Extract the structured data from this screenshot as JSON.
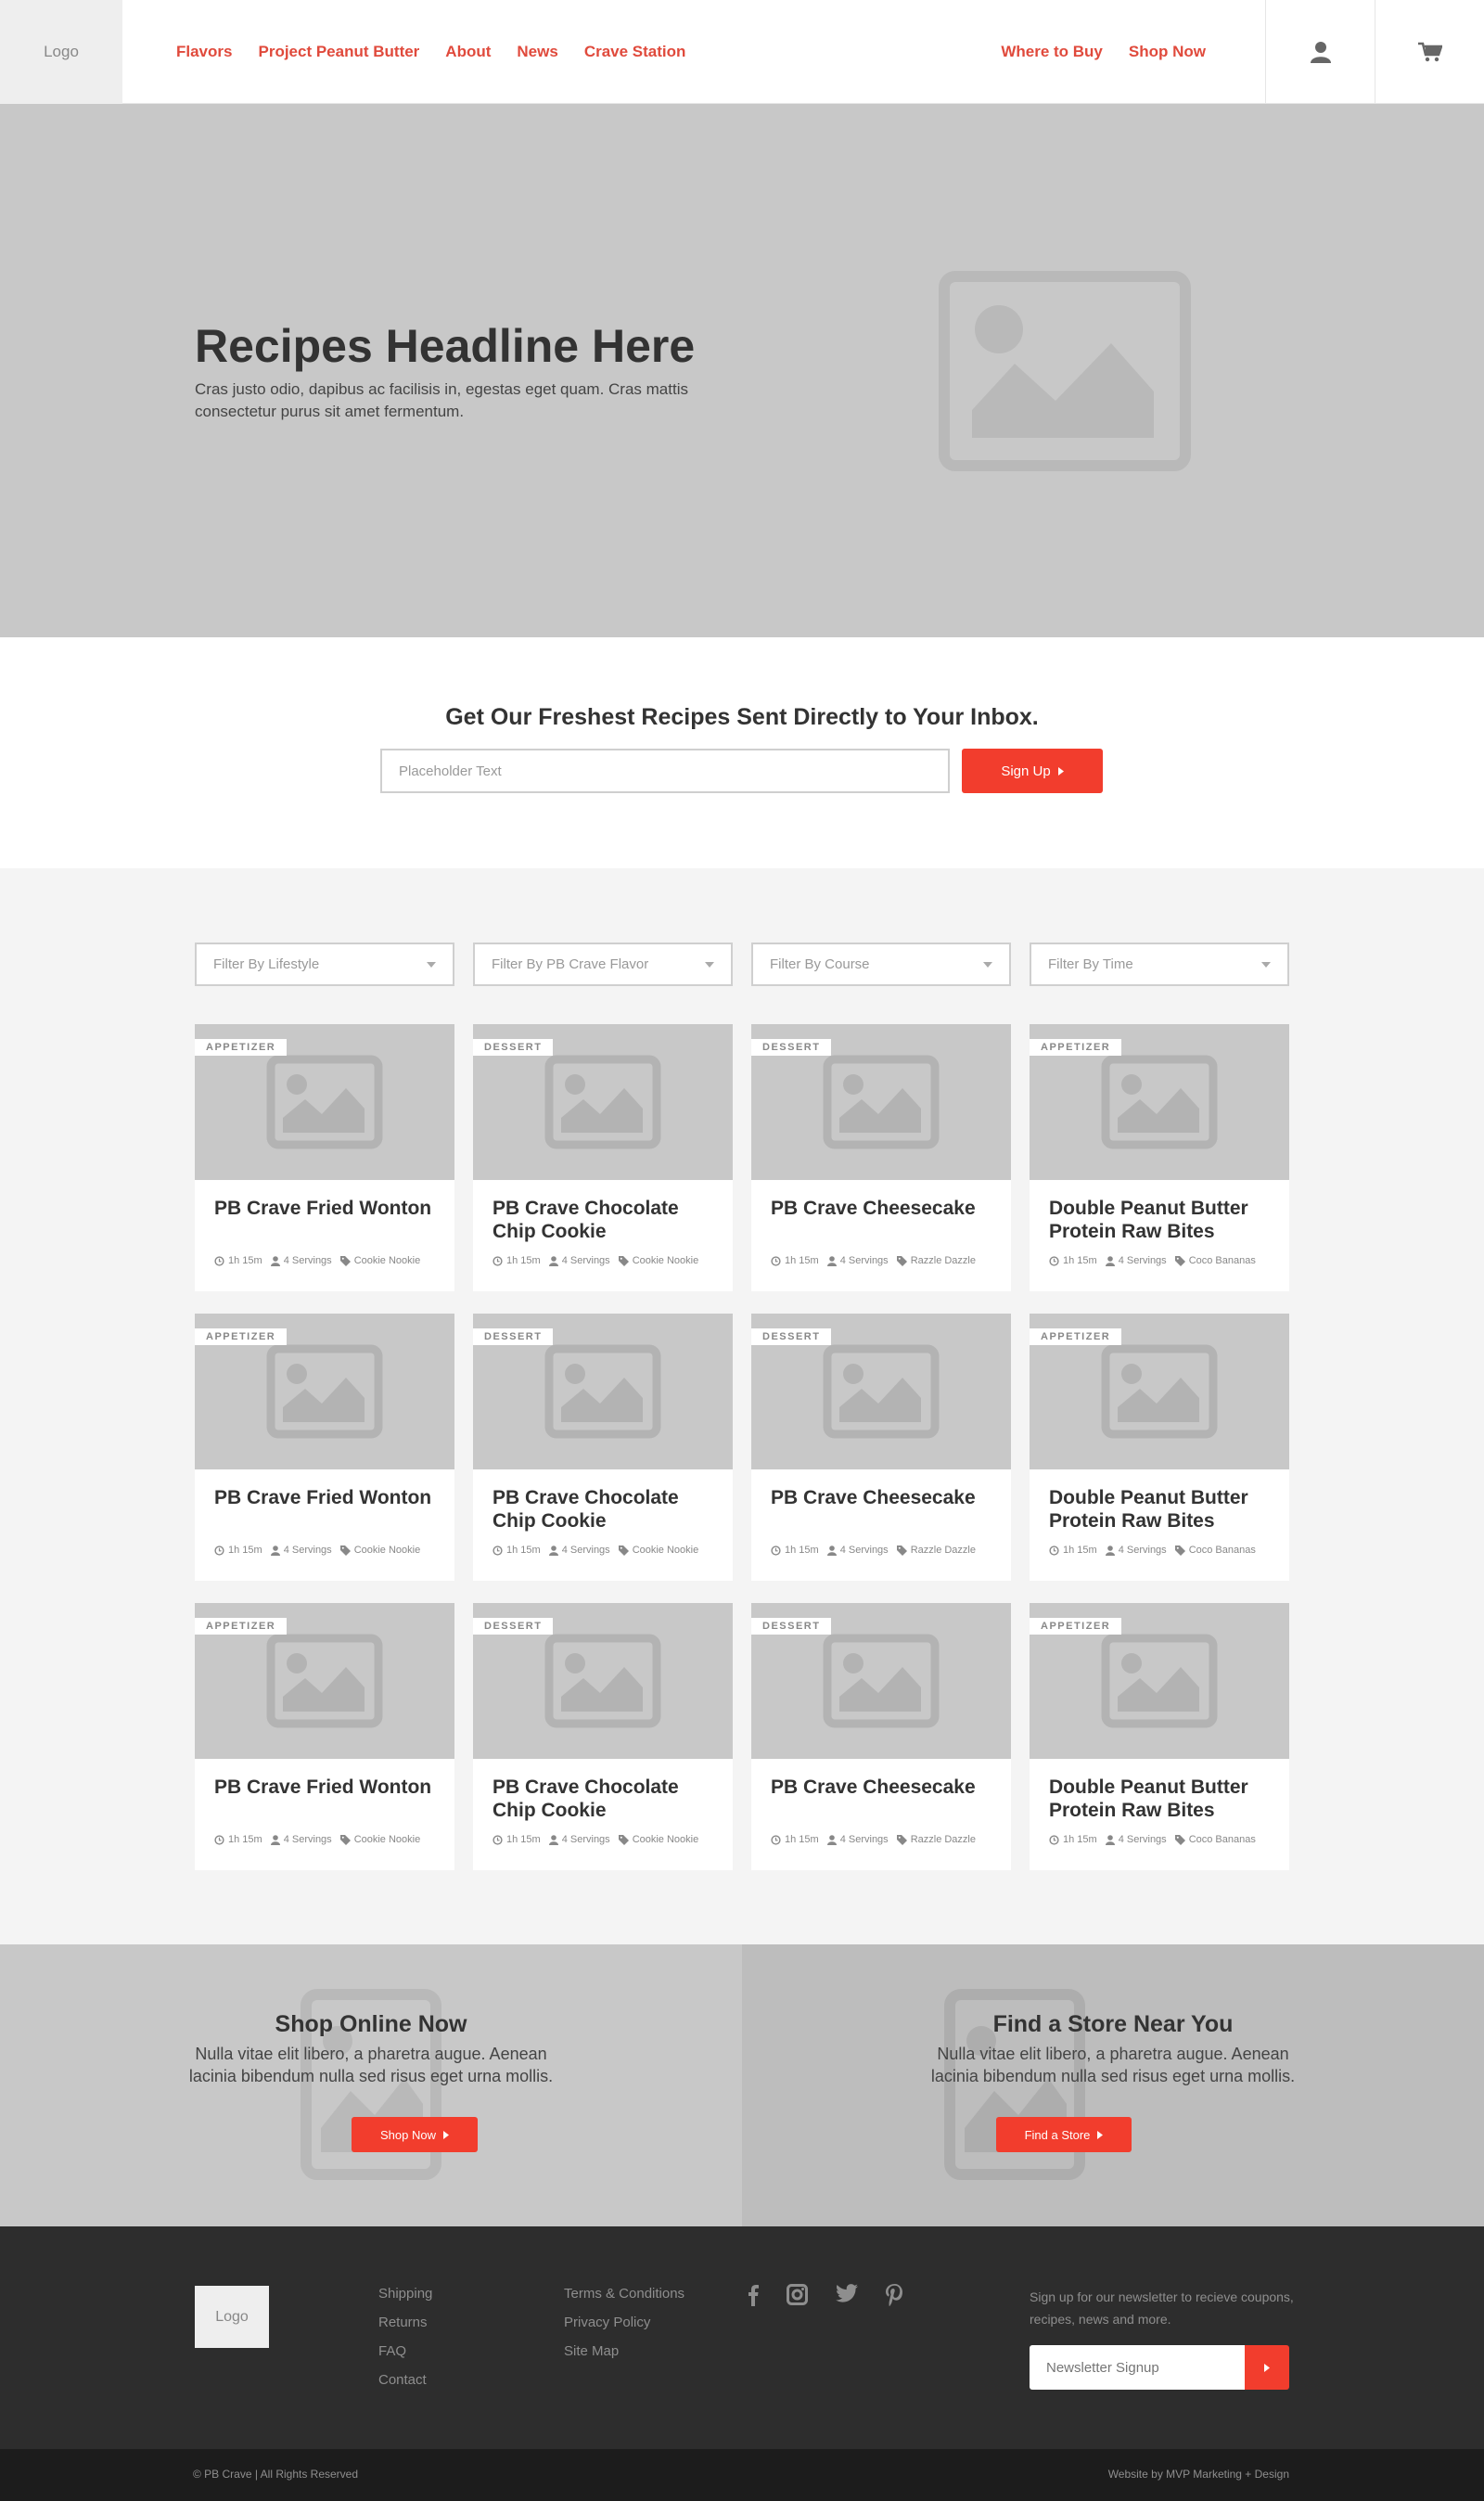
{
  "header": {
    "logo": "Logo",
    "nav_left": [
      "Flavors",
      "Project Peanut Butter",
      "About",
      "News",
      "Crave Station"
    ],
    "nav_right": [
      "Where to Buy",
      "Shop Now"
    ],
    "account_icon": "user-icon",
    "cart_icon": "cart-icon",
    "accent_color": "#e04a3c"
  },
  "hero": {
    "title": "Recipes Headline Here",
    "subtitle": "Cras justo odio, dapibus ac facilisis in, egestas eget quam. Cras mattis consectetur purus sit amet fermentum."
  },
  "newsletter": {
    "heading": "Get Our Freshest Recipes Sent Directly to Your Inbox.",
    "placeholder": "Placeholder Text",
    "button": "Sign Up",
    "button_color": "#f23d2d"
  },
  "filters": [
    "Filter By Lifestyle",
    "Filter By PB Crave Flavor",
    "Filter By Course",
    "Filter By Time"
  ],
  "recipes": [
    {
      "category": "APPETIZER",
      "title": "PB Crave Fried Wonton",
      "time": "1h 15m",
      "servings": "4 Servings",
      "flavor": "Cookie Nookie"
    },
    {
      "category": "DESSERT",
      "title": "PB Crave Chocolate Chip Cookie",
      "time": "1h 15m",
      "servings": "4 Servings",
      "flavor": "Cookie Nookie"
    },
    {
      "category": "DESSERT",
      "title": "PB Crave Cheesecake",
      "time": "1h 15m",
      "servings": "4 Servings",
      "flavor": "Razzle Dazzle"
    },
    {
      "category": "APPETIZER",
      "title": "Double Peanut Butter Protein Raw Bites",
      "time": "1h 15m",
      "servings": "4 Servings",
      "flavor": "Coco Bananas"
    },
    {
      "category": "APPETIZER",
      "title": "PB Crave Fried Wonton",
      "time": "1h 15m",
      "servings": "4 Servings",
      "flavor": "Cookie Nookie"
    },
    {
      "category": "DESSERT",
      "title": "PB Crave Chocolate Chip Cookie",
      "time": "1h 15m",
      "servings": "4 Servings",
      "flavor": "Cookie Nookie"
    },
    {
      "category": "DESSERT",
      "title": "PB Crave Cheesecake",
      "time": "1h 15m",
      "servings": "4 Servings",
      "flavor": "Razzle Dazzle"
    },
    {
      "category": "APPETIZER",
      "title": "Double Peanut Butter Protein Raw Bites",
      "time": "1h 15m",
      "servings": "4 Servings",
      "flavor": "Coco Bananas"
    },
    {
      "category": "APPETIZER",
      "title": "PB Crave Fried Wonton",
      "time": "1h 15m",
      "servings": "4 Servings",
      "flavor": "Cookie Nookie"
    },
    {
      "category": "DESSERT",
      "title": "PB Crave Chocolate Chip Cookie",
      "time": "1h 15m",
      "servings": "4 Servings",
      "flavor": "Cookie Nookie"
    },
    {
      "category": "DESSERT",
      "title": "PB Crave Cheesecake",
      "time": "1h 15m",
      "servings": "4 Servings",
      "flavor": "Razzle Dazzle"
    },
    {
      "category": "APPETIZER",
      "title": "Double Peanut Butter Protein Raw Bites",
      "time": "1h 15m",
      "servings": "4 Servings",
      "flavor": "Coco Bananas"
    }
  ],
  "promos": {
    "shop": {
      "title": "Shop Online Now",
      "text": "Nulla vitae elit libero, a pharetra augue. Aenean lacinia bibendum nulla sed risus eget urna mollis.",
      "button": "Shop Now"
    },
    "store": {
      "title": "Find a Store Near You",
      "text": "Nulla vitae elit libero, a pharetra augue. Aenean lacinia bibendum nulla sed risus eget urna mollis.",
      "button": "Find a Store"
    }
  },
  "footer": {
    "logo": "Logo",
    "col1": [
      "Shipping",
      "Returns",
      "FAQ",
      "Contact"
    ],
    "col2": [
      "Terms & Conditions",
      "Privacy Policy",
      "Site Map"
    ],
    "social": [
      "facebook-icon",
      "instagram-icon",
      "twitter-icon",
      "pinterest-icon"
    ],
    "newsletter_text": "Sign up for our newsletter to recieve coupons, recipes, news and more.",
    "newsletter_placeholder": "Newsletter Signup",
    "copyright": "© PB Crave  |  All Rights Reserved",
    "credit": "Website by MVP Marketing + Design"
  }
}
